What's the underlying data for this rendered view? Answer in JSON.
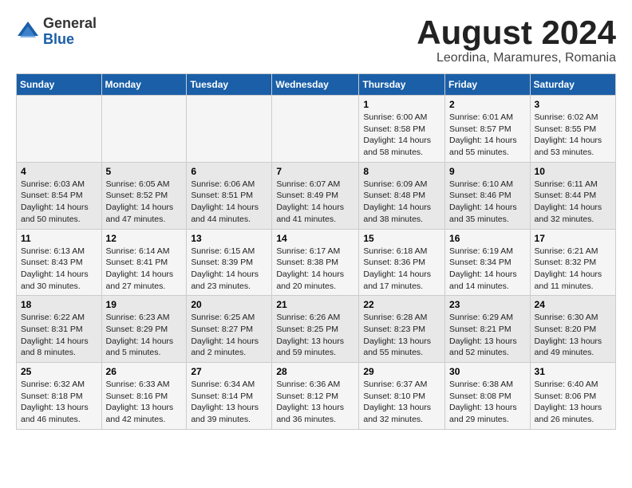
{
  "logo": {
    "general": "General",
    "blue": "Blue"
  },
  "title": "August 2024",
  "location": "Leordina, Maramures, Romania",
  "days_of_week": [
    "Sunday",
    "Monday",
    "Tuesday",
    "Wednesday",
    "Thursday",
    "Friday",
    "Saturday"
  ],
  "weeks": [
    [
      {
        "day": "",
        "info": ""
      },
      {
        "day": "",
        "info": ""
      },
      {
        "day": "",
        "info": ""
      },
      {
        "day": "",
        "info": ""
      },
      {
        "day": "1",
        "info": "Sunrise: 6:00 AM\nSunset: 8:58 PM\nDaylight: 14 hours and 58 minutes."
      },
      {
        "day": "2",
        "info": "Sunrise: 6:01 AM\nSunset: 8:57 PM\nDaylight: 14 hours and 55 minutes."
      },
      {
        "day": "3",
        "info": "Sunrise: 6:02 AM\nSunset: 8:55 PM\nDaylight: 14 hours and 53 minutes."
      }
    ],
    [
      {
        "day": "4",
        "info": "Sunrise: 6:03 AM\nSunset: 8:54 PM\nDaylight: 14 hours and 50 minutes."
      },
      {
        "day": "5",
        "info": "Sunrise: 6:05 AM\nSunset: 8:52 PM\nDaylight: 14 hours and 47 minutes."
      },
      {
        "day": "6",
        "info": "Sunrise: 6:06 AM\nSunset: 8:51 PM\nDaylight: 14 hours and 44 minutes."
      },
      {
        "day": "7",
        "info": "Sunrise: 6:07 AM\nSunset: 8:49 PM\nDaylight: 14 hours and 41 minutes."
      },
      {
        "day": "8",
        "info": "Sunrise: 6:09 AM\nSunset: 8:48 PM\nDaylight: 14 hours and 38 minutes."
      },
      {
        "day": "9",
        "info": "Sunrise: 6:10 AM\nSunset: 8:46 PM\nDaylight: 14 hours and 35 minutes."
      },
      {
        "day": "10",
        "info": "Sunrise: 6:11 AM\nSunset: 8:44 PM\nDaylight: 14 hours and 32 minutes."
      }
    ],
    [
      {
        "day": "11",
        "info": "Sunrise: 6:13 AM\nSunset: 8:43 PM\nDaylight: 14 hours and 30 minutes."
      },
      {
        "day": "12",
        "info": "Sunrise: 6:14 AM\nSunset: 8:41 PM\nDaylight: 14 hours and 27 minutes."
      },
      {
        "day": "13",
        "info": "Sunrise: 6:15 AM\nSunset: 8:39 PM\nDaylight: 14 hours and 23 minutes."
      },
      {
        "day": "14",
        "info": "Sunrise: 6:17 AM\nSunset: 8:38 PM\nDaylight: 14 hours and 20 minutes."
      },
      {
        "day": "15",
        "info": "Sunrise: 6:18 AM\nSunset: 8:36 PM\nDaylight: 14 hours and 17 minutes."
      },
      {
        "day": "16",
        "info": "Sunrise: 6:19 AM\nSunset: 8:34 PM\nDaylight: 14 hours and 14 minutes."
      },
      {
        "day": "17",
        "info": "Sunrise: 6:21 AM\nSunset: 8:32 PM\nDaylight: 14 hours and 11 minutes."
      }
    ],
    [
      {
        "day": "18",
        "info": "Sunrise: 6:22 AM\nSunset: 8:31 PM\nDaylight: 14 hours and 8 minutes."
      },
      {
        "day": "19",
        "info": "Sunrise: 6:23 AM\nSunset: 8:29 PM\nDaylight: 14 hours and 5 minutes."
      },
      {
        "day": "20",
        "info": "Sunrise: 6:25 AM\nSunset: 8:27 PM\nDaylight: 14 hours and 2 minutes."
      },
      {
        "day": "21",
        "info": "Sunrise: 6:26 AM\nSunset: 8:25 PM\nDaylight: 13 hours and 59 minutes."
      },
      {
        "day": "22",
        "info": "Sunrise: 6:28 AM\nSunset: 8:23 PM\nDaylight: 13 hours and 55 minutes."
      },
      {
        "day": "23",
        "info": "Sunrise: 6:29 AM\nSunset: 8:21 PM\nDaylight: 13 hours and 52 minutes."
      },
      {
        "day": "24",
        "info": "Sunrise: 6:30 AM\nSunset: 8:20 PM\nDaylight: 13 hours and 49 minutes."
      }
    ],
    [
      {
        "day": "25",
        "info": "Sunrise: 6:32 AM\nSunset: 8:18 PM\nDaylight: 13 hours and 46 minutes."
      },
      {
        "day": "26",
        "info": "Sunrise: 6:33 AM\nSunset: 8:16 PM\nDaylight: 13 hours and 42 minutes."
      },
      {
        "day": "27",
        "info": "Sunrise: 6:34 AM\nSunset: 8:14 PM\nDaylight: 13 hours and 39 minutes."
      },
      {
        "day": "28",
        "info": "Sunrise: 6:36 AM\nSunset: 8:12 PM\nDaylight: 13 hours and 36 minutes."
      },
      {
        "day": "29",
        "info": "Sunrise: 6:37 AM\nSunset: 8:10 PM\nDaylight: 13 hours and 32 minutes."
      },
      {
        "day": "30",
        "info": "Sunrise: 6:38 AM\nSunset: 8:08 PM\nDaylight: 13 hours and 29 minutes."
      },
      {
        "day": "31",
        "info": "Sunrise: 6:40 AM\nSunset: 8:06 PM\nDaylight: 13 hours and 26 minutes."
      }
    ]
  ]
}
